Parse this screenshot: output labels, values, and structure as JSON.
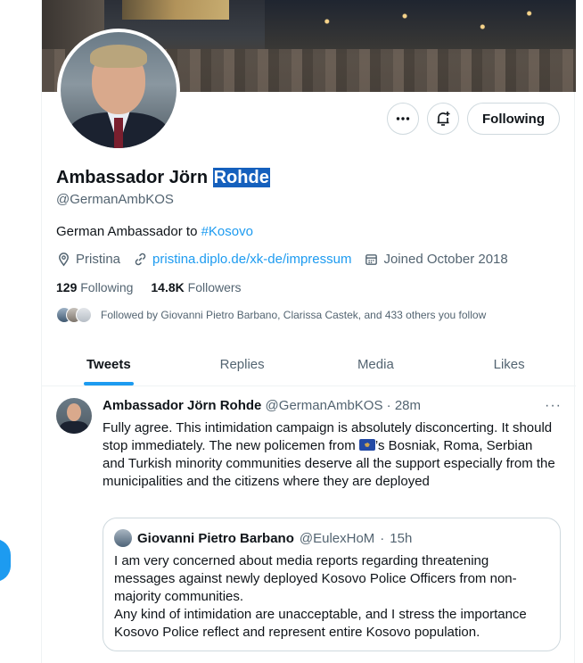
{
  "profile": {
    "name_first": "Ambassador Jörn ",
    "name_highlight": "Rohde",
    "handle": "@GermanAmbKOS",
    "bio_text": "German Ambassador to ",
    "bio_hashtag": "#Kosovo",
    "location": "Pristina",
    "website": "pristina.diplo.de/xk-de/impressum",
    "joined": "Joined October 2018",
    "following_count": "129",
    "following_label": "Following",
    "followers_count": "14.8K",
    "followers_label": "Followers",
    "followed_by": "Followed by Giovanni Pietro Barbano, Clarissa Castek, and 433 others you follow"
  },
  "actions": {
    "more_icon": "more-horizontal-icon",
    "notify_icon": "notification-bell-icon",
    "follow_label": "Following"
  },
  "tabs": [
    {
      "label": "Tweets",
      "active": true
    },
    {
      "label": "Replies",
      "active": false
    },
    {
      "label": "Media",
      "active": false
    },
    {
      "label": "Likes",
      "active": false
    }
  ],
  "tweet": {
    "author": "Ambassador Jörn Rohde",
    "handle": "@GermanAmbKOS",
    "separator": "·",
    "time": "28m",
    "more": "···",
    "text_before_flag": "Fully agree. This intimidation campaign is absolutely disconcerting. It should stop immediately. The new policemen from ",
    "text_after_flag": "’s Bosniak, Roma, Serbian and Turkish minority communities deserve all the support especially from the municipalities and the citizens where they are deployed",
    "quote": {
      "author": "Giovanni Pietro Barbano",
      "handle": "@EulexHoM",
      "separator": "·",
      "time": "15h",
      "text_line1": "I am very concerned about media reports regarding threatening messages against newly deployed Kosovo Police Officers from non-majority communities.",
      "text_line2": "Any kind of intimidation are unacceptable, and I stress the importance Kosovo Police reflect and represent entire Kosovo population."
    }
  },
  "colors": {
    "accent": "#1d9bf0",
    "text": "#0f1419",
    "muted": "#536471",
    "border": "#cfd9de",
    "highlight": "#1560bd"
  }
}
